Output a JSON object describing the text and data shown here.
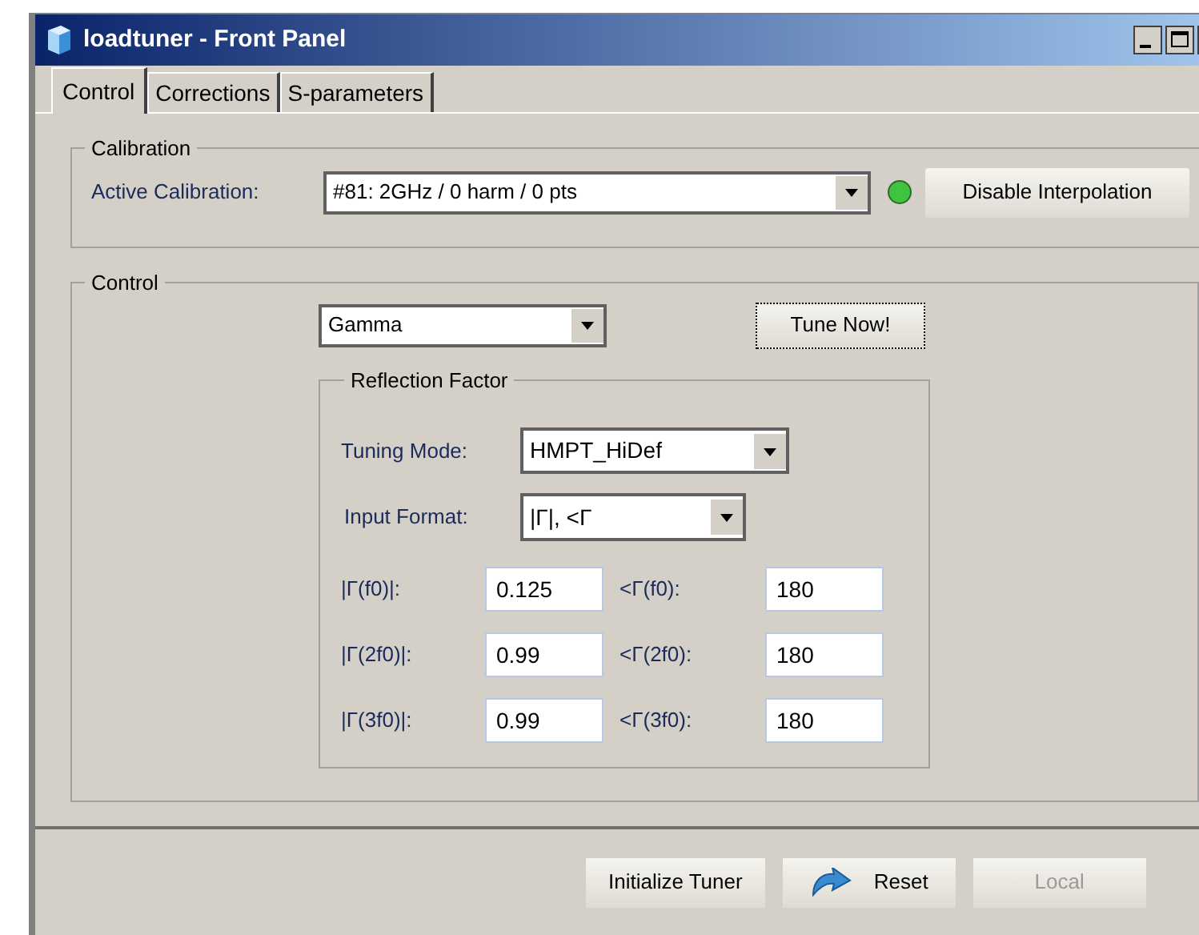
{
  "window": {
    "title": "loadtuner - Front Panel"
  },
  "tabs": [
    {
      "label": "Control",
      "selected": true
    },
    {
      "label": "Corrections",
      "selected": false
    },
    {
      "label": "S-parameters",
      "selected": false
    }
  ],
  "calibration": {
    "title": "Calibration",
    "label": "Active Calibration:",
    "value": "#81: 2GHz / 0 harm / 0 pts",
    "indicator_on": true,
    "button": "Disable Interpolation"
  },
  "control": {
    "title": "Control",
    "mode": "Gamma",
    "tune_button": {
      "label": "Tune Now!",
      "focused": true
    },
    "reflection": {
      "title": "Reflection Factor",
      "tuning_mode": {
        "label": "Tuning Mode:",
        "value": "HMPT_HiDef"
      },
      "input_format": {
        "label": "Input Format:",
        "value": "|Γ|, <Γ"
      },
      "rows": [
        {
          "magnitude_label": "|Γ(f0)|:",
          "magnitude": "0.125",
          "angle_label": "<Γ(f0):",
          "angle": "180"
        },
        {
          "magnitude_label": "|Γ(2f0)|:",
          "magnitude": "0.99",
          "angle_label": "<Γ(2f0):",
          "angle": "180"
        },
        {
          "magnitude_label": "|Γ(3f0)|:",
          "magnitude": "0.99",
          "angle_label": "<Γ(3f0):",
          "angle": "180"
        }
      ]
    }
  },
  "footer_buttons": [
    {
      "label": "Initialize Tuner",
      "kind": "plain",
      "disabled": false
    },
    {
      "label": "Reset",
      "kind": "icon",
      "disabled": false
    },
    {
      "label": "Local",
      "kind": "plain",
      "disabled": true
    }
  ]
}
